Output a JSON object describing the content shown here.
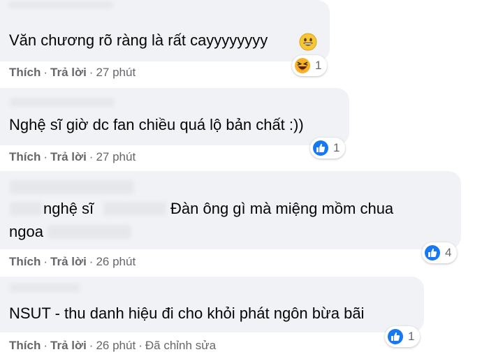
{
  "comments": [
    {
      "text": "Văn chương rõ ràng là rất cayyyyyyyy",
      "actions": {
        "like": "Thích",
        "reply": "Trả lời",
        "time": "27 phút"
      },
      "reactions": {
        "count": "1"
      }
    },
    {
      "text": "Nghệ sĩ giờ dc fan chiều quá lộ bản chất :))",
      "actions": {
        "like": "Thích",
        "reply": "Trả lời",
        "time": "27 phút"
      },
      "reactions": {
        "count": "1"
      }
    },
    {
      "text_line1_a": "nghệ sĩ",
      "text_line1_b": "Đàn ông gì mà miệng mồm chua",
      "text_line2": "ngoa",
      "actions": {
        "like": "Thích",
        "reply": "Trả lời",
        "time": "26 phút"
      },
      "reactions": {
        "count": "4"
      }
    },
    {
      "text": "NSUT - thu danh hiệu đi cho khỏi phát ngôn bừa bãi",
      "actions": {
        "like": "Thích",
        "reply": "Trả lời",
        "time": "26 phút",
        "edited": "Đã chỉnh sửa"
      },
      "reactions": {
        "count": "1"
      }
    }
  ],
  "separator": "·",
  "colors": {
    "bubble": "#f0f2f5",
    "meta": "#65676b",
    "like_blue": "#1877f2",
    "haha_yellow": "#f7b125"
  },
  "icons": [
    "grinning-emoji-icon",
    "haha-reaction-icon",
    "like-reaction-icon"
  ]
}
